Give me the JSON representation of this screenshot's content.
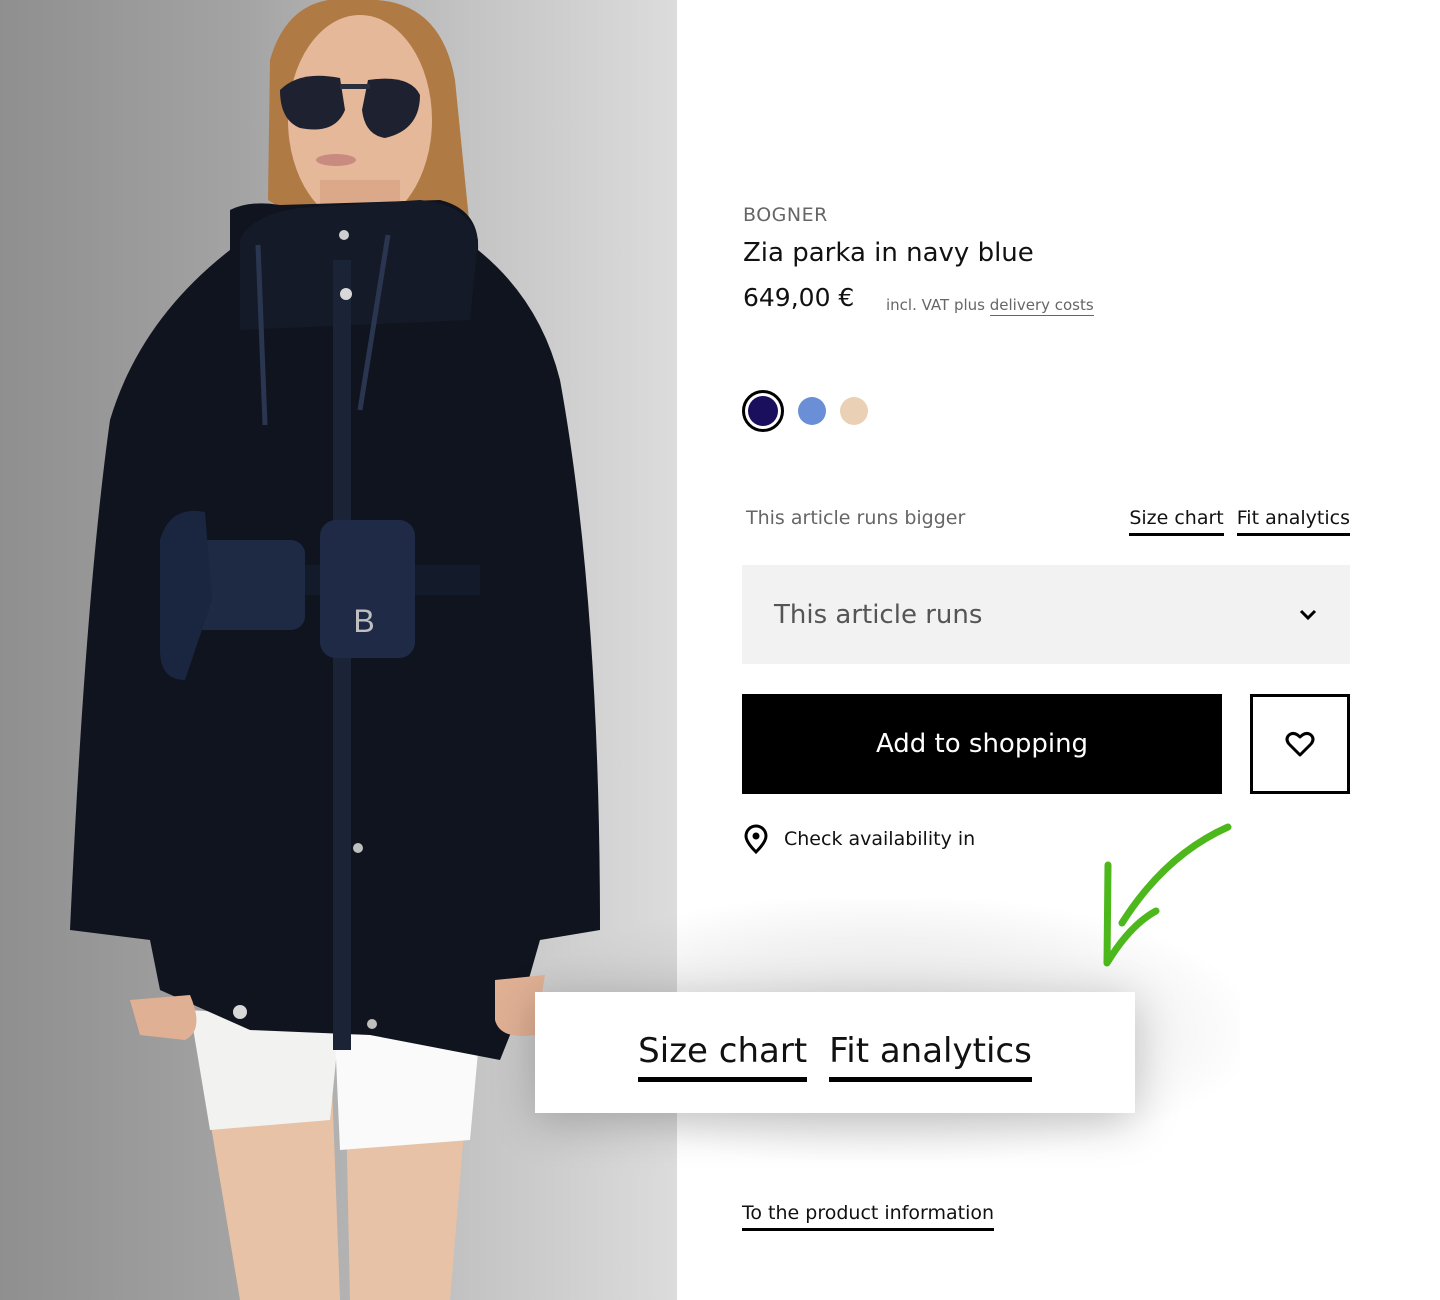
{
  "product": {
    "brand": "BOGNER",
    "title": "Zia parka in navy blue",
    "price": "649,00 €",
    "vat_text": "incl. VAT plus",
    "delivery_link": "delivery costs"
  },
  "colors": {
    "selected_index": 0,
    "swatches": [
      {
        "name": "navy blue",
        "hex": "#1a0f5c"
      },
      {
        "name": "light blue",
        "hex": "#6a8fd6"
      },
      {
        "name": "beige",
        "hex": "#ead0b5"
      }
    ]
  },
  "fit": {
    "note": "This article runs bigger",
    "size_chart_link": "Size chart",
    "fit_analytics_link": "Fit analytics"
  },
  "size_select": {
    "placeholder": "This article runs"
  },
  "actions": {
    "add_to_cart": "Add to shopping",
    "wishlist_icon": "heart-icon",
    "availability": "Check availability in",
    "availability_icon": "location-pin-icon"
  },
  "callout": {
    "size_chart_link": "Size chart",
    "fit_analytics_link": "Fit analytics",
    "arrow_color": "#4cb81c"
  },
  "footer": {
    "product_info_link": "To the product information"
  },
  "image": {
    "description": "Model wearing navy Zia parka with belt bags, white shorts and sunglasses"
  }
}
